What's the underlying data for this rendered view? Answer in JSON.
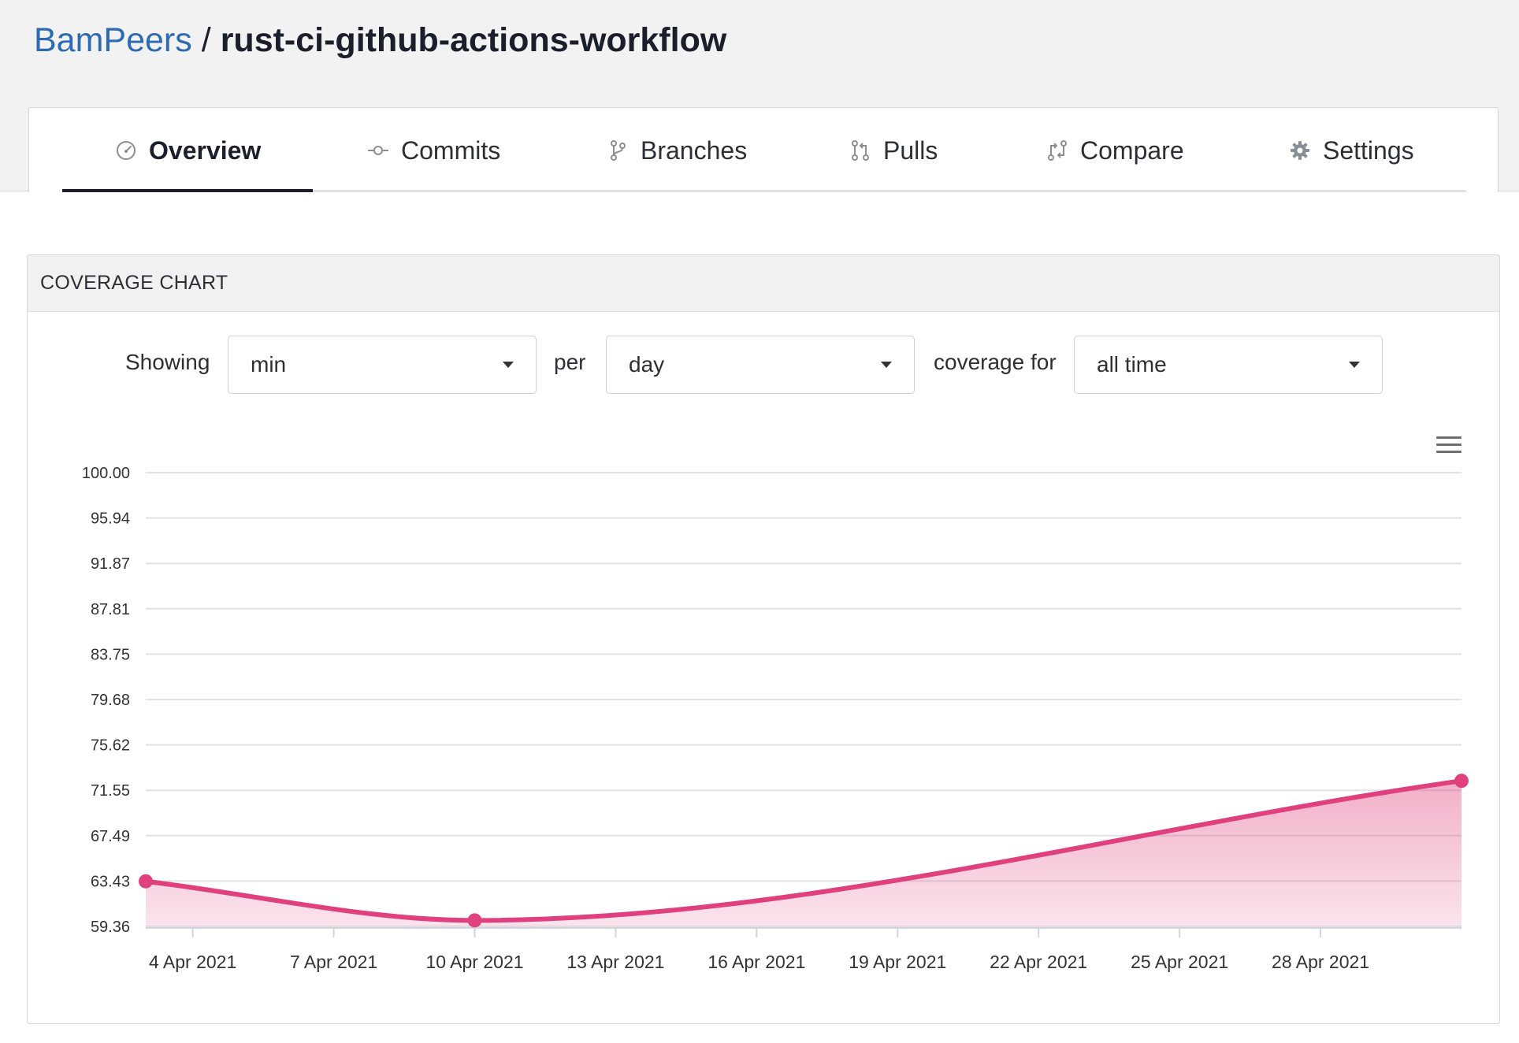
{
  "breadcrumb": {
    "owner": "BamPeers",
    "separator": "/",
    "repo": "rust-ci-github-actions-workflow"
  },
  "tabs": [
    {
      "label": "Overview",
      "icon": "gauge-icon",
      "active": true
    },
    {
      "label": "Commits",
      "icon": "commit-icon",
      "active": false
    },
    {
      "label": "Branches",
      "icon": "branch-icon",
      "active": false
    },
    {
      "label": "Pulls",
      "icon": "pull-request-icon",
      "active": false
    },
    {
      "label": "Compare",
      "icon": "compare-icon",
      "active": false
    },
    {
      "label": "Settings",
      "icon": "gear-icon",
      "active": false
    }
  ],
  "card": {
    "title": "COVERAGE CHART",
    "controls": {
      "showing_label": "Showing",
      "metric_value": "min",
      "per_label": "per",
      "period_value": "day",
      "coverage_label": "coverage for",
      "range_value": "all time"
    },
    "menu_icon": "hamburger-menu-icon"
  },
  "chart_data": {
    "type": "area",
    "title": "",
    "xlabel": "",
    "ylabel": "",
    "ylim": [
      59.36,
      100.0
    ],
    "yticks": [
      "100.00",
      "95.94",
      "91.87",
      "87.81",
      "83.75",
      "79.68",
      "75.62",
      "71.55",
      "67.49",
      "63.43",
      "59.36"
    ],
    "xlim": [
      "2021-04-03",
      "2021-05-01"
    ],
    "xticks": [
      {
        "date": "2021-04-04",
        "label": "4 Apr 2021"
      },
      {
        "date": "2021-04-07",
        "label": "7 Apr 2021"
      },
      {
        "date": "2021-04-10",
        "label": "10 Apr 2021"
      },
      {
        "date": "2021-04-13",
        "label": "13 Apr 2021"
      },
      {
        "date": "2021-04-16",
        "label": "16 Apr 2021"
      },
      {
        "date": "2021-04-19",
        "label": "19 Apr 2021"
      },
      {
        "date": "2021-04-22",
        "label": "22 Apr 2021"
      },
      {
        "date": "2021-04-25",
        "label": "25 Apr 2021"
      },
      {
        "date": "2021-04-28",
        "label": "28 Apr 2021"
      }
    ],
    "series": [
      {
        "color": "#e0407e",
        "points": [
          {
            "x": "2021-04-03",
            "y": 63.4
          },
          {
            "x": "2021-04-10",
            "y": 59.9
          },
          {
            "x": "2021-05-01",
            "y": 72.4
          }
        ]
      }
    ],
    "grid": true,
    "legend": "none"
  }
}
